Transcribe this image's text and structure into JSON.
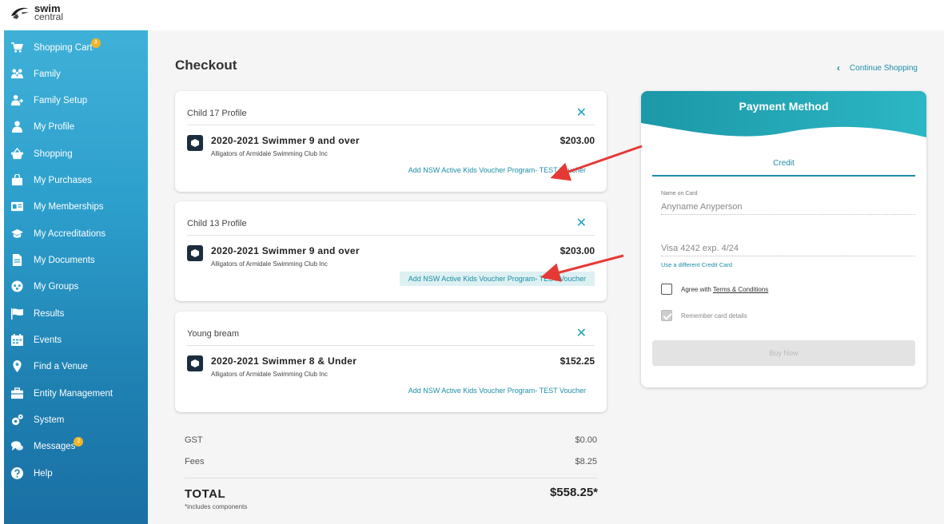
{
  "brand": {
    "line1": "swim",
    "line2": "central"
  },
  "sidebar": {
    "items": [
      {
        "label": "Shopping Cart",
        "icon": "cart-icon",
        "badge": "3"
      },
      {
        "label": "Family",
        "icon": "family-icon"
      },
      {
        "label": "Family Setup",
        "icon": "add-user-icon"
      },
      {
        "label": "My Profile",
        "icon": "person-icon"
      },
      {
        "label": "Shopping",
        "icon": "basket-icon"
      },
      {
        "label": "My Purchases",
        "icon": "bag-icon"
      },
      {
        "label": "My Memberships",
        "icon": "id-card-icon"
      },
      {
        "label": "My Accreditations",
        "icon": "graduation-cap-icon"
      },
      {
        "label": "My Documents",
        "icon": "document-icon"
      },
      {
        "label": "My Groups",
        "icon": "groups-icon"
      },
      {
        "label": "Results",
        "icon": "flag-icon"
      },
      {
        "label": "Events",
        "icon": "calendar-icon"
      },
      {
        "label": "Find a Venue",
        "icon": "map-pin-icon"
      },
      {
        "label": "Entity Management",
        "icon": "briefcase-icon"
      },
      {
        "label": "System",
        "icon": "gears-icon"
      },
      {
        "label": "Messages",
        "icon": "chat-icon",
        "badge": "2"
      },
      {
        "label": "Help",
        "icon": "help-icon"
      }
    ]
  },
  "main": {
    "title": "Checkout",
    "continue_label": "Continue Shopping",
    "cart_items": [
      {
        "profile": "Child 17 Profile",
        "product": "2020-2021 Swimmer 9 and over",
        "club": "Alligators of Armidale Swimming Club Inc",
        "price": "$203.00",
        "voucher": "Add NSW Active Kids Voucher Program- TEST Voucher"
      },
      {
        "profile": "Child 13 Profile",
        "product": "2020-2021 Swimmer 9 and over",
        "club": "Alligators of Armidale Swimming Club Inc",
        "price": "$203.00",
        "voucher": "Add NSW Active Kids Voucher Program- TEST Voucher"
      },
      {
        "profile": "Young bream",
        "product": "2020-2021 Swimmer 8 & Under",
        "club": "Alligators of Armidale Swimming Club Inc",
        "price": "$152.25",
        "voucher": "Add NSW Active Kids Voucher Program- TEST Voucher"
      }
    ],
    "totals": {
      "gst_label": "GST",
      "gst_value": "$0.00",
      "fees_label": "Fees",
      "fees_value": "$8.25",
      "total_label": "TOTAL",
      "total_value": "$558.25*",
      "note": "*includes components"
    }
  },
  "payment": {
    "title": "Payment Method",
    "tab": "Credit",
    "name_label": "Name on Card",
    "name_value": "Anyname Anyperson",
    "card_value": "Visa 4242 exp. 4/24",
    "different_card": "Use a different Credit Card",
    "agree_prefix": "Agree with ",
    "agree_link": "Terms & Conditions",
    "agree_checked": false,
    "remember": "Remember card details",
    "remember_checked": true,
    "buy": "Buy Now"
  },
  "colors": {
    "teal": "#1b8ea8",
    "badge": "#f0b429",
    "arrow": "#e53935"
  }
}
